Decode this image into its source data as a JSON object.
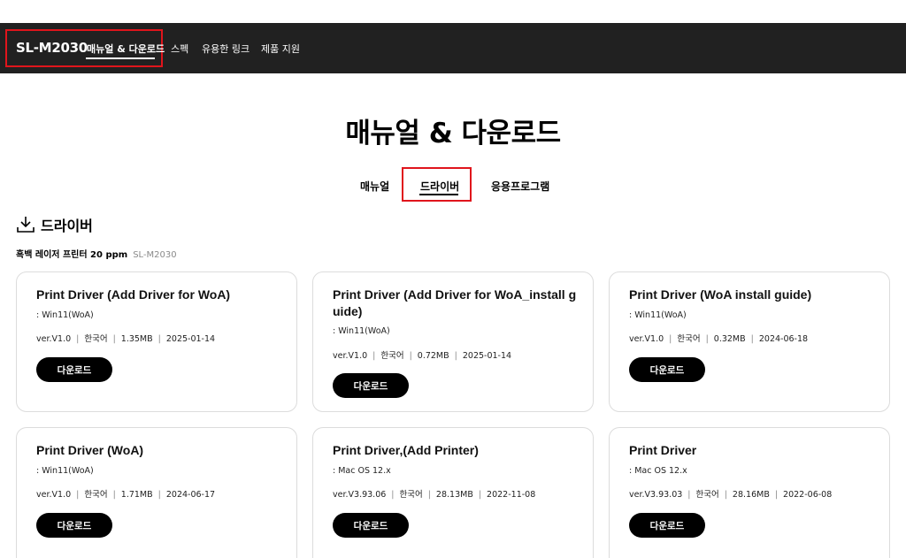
{
  "topnav": {
    "model": "SL-M2030",
    "items": [
      {
        "label": "매뉴얼 & 다운로드",
        "active": true
      },
      {
        "label": "스펙",
        "active": false
      },
      {
        "label": "유용한 링크",
        "active": false
      },
      {
        "label": "제품 지원",
        "active": false
      }
    ]
  },
  "page_title": "매뉴얼 & 다운로드",
  "tabs": [
    {
      "label": "매뉴얼",
      "active": false
    },
    {
      "label": "드라이버",
      "active": true
    },
    {
      "label": "응용프로그램",
      "active": false
    }
  ],
  "section": {
    "icon": "download-icon",
    "title": "드라이버",
    "product_desc": "흑백 레이저 프린터 20 ppm",
    "product_model": "SL-M2030"
  },
  "cards": [
    {
      "title": "Print Driver (Add Driver for WoA)",
      "os": ": Win11(WoA)",
      "version": "ver.V1.0",
      "language": "한국어",
      "size": "1.35MB",
      "date": "2025-01-14",
      "button": "다운로드"
    },
    {
      "title": "Print Driver (Add Driver for WoA_install guide)",
      "os": ": Win11(WoA)",
      "version": "ver.V1.0",
      "language": "한국어",
      "size": "0.72MB",
      "date": "2025-01-14",
      "button": "다운로드"
    },
    {
      "title": "Print Driver (WoA install guide)",
      "os": ": Win11(WoA)",
      "version": "ver.V1.0",
      "language": "한국어",
      "size": "0.32MB",
      "date": "2024-06-18",
      "button": "다운로드"
    },
    {
      "title": "Print Driver (WoA)",
      "os": ": Win11(WoA)",
      "version": "ver.V1.0",
      "language": "한국어",
      "size": "1.71MB",
      "date": "2024-06-17",
      "button": "다운로드"
    },
    {
      "title": "Print Driver,(Add Printer)",
      "os": ": Mac OS 12.x",
      "version": "ver.V3.93.06",
      "language": "한국어",
      "size": "28.13MB",
      "date": "2022-11-08",
      "button": "다운로드"
    },
    {
      "title": "Print Driver",
      "os": ": Mac OS 12.x",
      "version": "ver.V3.93.03",
      "language": "한국어",
      "size": "28.16MB",
      "date": "2022-06-08",
      "button": "다운로드"
    }
  ],
  "colors": {
    "nav_bg": "#212121",
    "highlight": "#e0151c",
    "button_bg": "#000000"
  }
}
